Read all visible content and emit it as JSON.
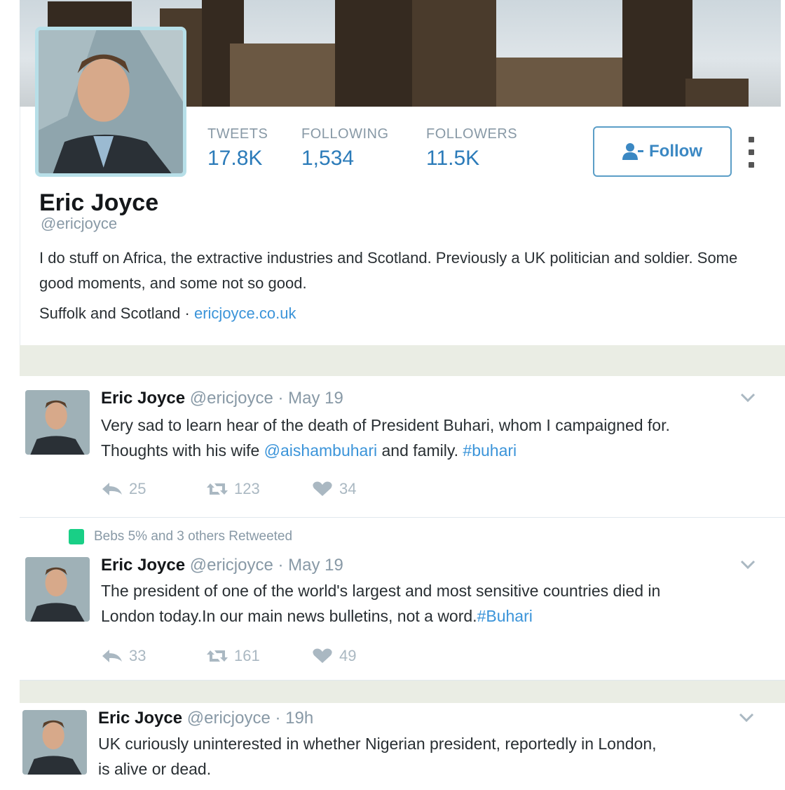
{
  "profile": {
    "name": "Eric Joyce",
    "handle": "@ericjoyce",
    "bio": "I do stuff on Africa, the extractive industries and Scotland. Previously a UK politician and soldier. Some good moments, and some not so good.",
    "location": "Suffolk and Scotland",
    "separator": "·",
    "website": "ericjoyce.co.uk",
    "stats": [
      {
        "label": "TWEETS",
        "value": "17.8K"
      },
      {
        "label": "FOLLOWING",
        "value": "1,534"
      },
      {
        "label": "FOLLOWERS",
        "value": "11.5K"
      }
    ],
    "follow_label": "Follow"
  },
  "tweets": [
    {
      "name": "Eric Joyce",
      "handle": "@ericjoyce",
      "date": "· May 19",
      "text_line1": "Very sad to learn hear of the death of President Buhari, whom I campaigned for.",
      "text_line2_pre": "Thoughts with his wife ",
      "mention": "@aishambuhari",
      "text_line2_mid": " and family. ",
      "hashtag": "#buhari",
      "replies": "25",
      "retweets": "123",
      "likes": "34"
    },
    {
      "retweet_context": "Bebs 5% and 3 others Retweeted",
      "name": "Eric Joyce",
      "handle": "@ericjoyce",
      "date": "· May 19",
      "text_line1": "The president of one of the world's largest and most sensitive countries died in",
      "text_line2_pre": "London today.In our main news bulletins, not a word.",
      "hashtag": "#Buhari",
      "replies": "33",
      "retweets": "161",
      "likes": "49"
    },
    {
      "name": "Eric Joyce",
      "handle": "@ericjoyce",
      "date": "· 19h",
      "text_line1": "UK curiously uninterested in whether Nigerian president, reportedly in London,",
      "text_line2_pre": "is alive or dead."
    }
  ],
  "colors": {
    "link": "#3b94d9",
    "stat_value": "#2b7bb9",
    "muted": "#8899a6",
    "retweet_badge": "#19cf86"
  }
}
